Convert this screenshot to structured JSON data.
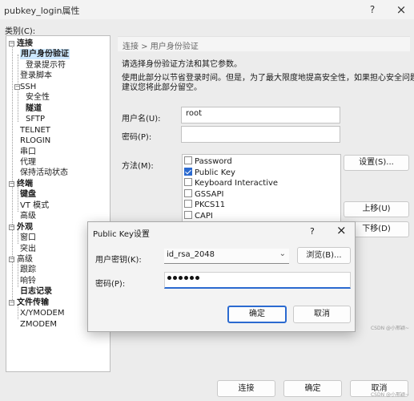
{
  "window": {
    "title": "pubkey_login属性",
    "help": "?",
    "close": "×"
  },
  "category_label": "类别(C):",
  "tree": [
    {
      "label": "连接",
      "bold": true
    },
    {
      "label": "用户身份验证",
      "bold": true,
      "selected": true
    },
    {
      "label": "登录提示符"
    },
    {
      "label": "登录脚本"
    },
    {
      "label": "SSH"
    },
    {
      "label": "安全性"
    },
    {
      "label": "隧道",
      "bold": true
    },
    {
      "label": "SFTP"
    },
    {
      "label": "TELNET"
    },
    {
      "label": "RLOGIN"
    },
    {
      "label": "串口"
    },
    {
      "label": "代理"
    },
    {
      "label": "保持活动状态"
    },
    {
      "label": "终端",
      "bold": true
    },
    {
      "label": "键盘",
      "bold": true
    },
    {
      "label": "VT 模式"
    },
    {
      "label": "高级"
    },
    {
      "label": "外观",
      "bold": true
    },
    {
      "label": "窗口"
    },
    {
      "label": "突出"
    },
    {
      "label": "高级"
    },
    {
      "label": "跟踪"
    },
    {
      "label": "响铃"
    },
    {
      "label": "日志记录",
      "bold": true
    },
    {
      "label": "文件传输",
      "bold": true
    },
    {
      "label": "X/YMODEM"
    },
    {
      "label": "ZMODEM"
    }
  ],
  "panel": {
    "breadcrumb": "连接 > 用户身份验证",
    "intro": "请选择身份验证方法和其它参数。",
    "note_line1": "使用此部分以节省登录时间。但是，为了最大限度地提高安全性，如果担心安全问题，",
    "note_line2": "建议您将此部分留空。",
    "username_label": "用户名(U):",
    "username_value": "root",
    "password_label": "密码(P):",
    "password_value": "",
    "method_label": "方法(M):",
    "methods": [
      {
        "label": "Password",
        "checked": false
      },
      {
        "label": "Public Key",
        "checked": true
      },
      {
        "label": "Keyboard Interactive",
        "checked": false
      },
      {
        "label": "GSSAPI",
        "checked": false
      },
      {
        "label": "PKCS11",
        "checked": false
      },
      {
        "label": "CAPI",
        "checked": false
      }
    ],
    "settings_button": "设置(S)...",
    "move_up_button": "上移(U)",
    "move_down_button": "下移(D)"
  },
  "dialog": {
    "title": "Public Key设置",
    "help": "?",
    "close": "×",
    "key_label": "用户密钥(K):",
    "key_value": "id_rsa_2048",
    "browse_button": "浏览(B)...",
    "passphrase_label": "密码(P):",
    "passphrase_mask_length": 6,
    "ok_button": "确定",
    "cancel_button": "取消"
  },
  "footer": {
    "connect_button": "连接",
    "ok_button": "确定",
    "cancel_button": "取消"
  },
  "watermark": "CSDN @小邢颖~",
  "watermark2": "CSDN @小邢颖~",
  "colors": {
    "accent": "#2b6ad0",
    "selection": "#cde8ff"
  }
}
